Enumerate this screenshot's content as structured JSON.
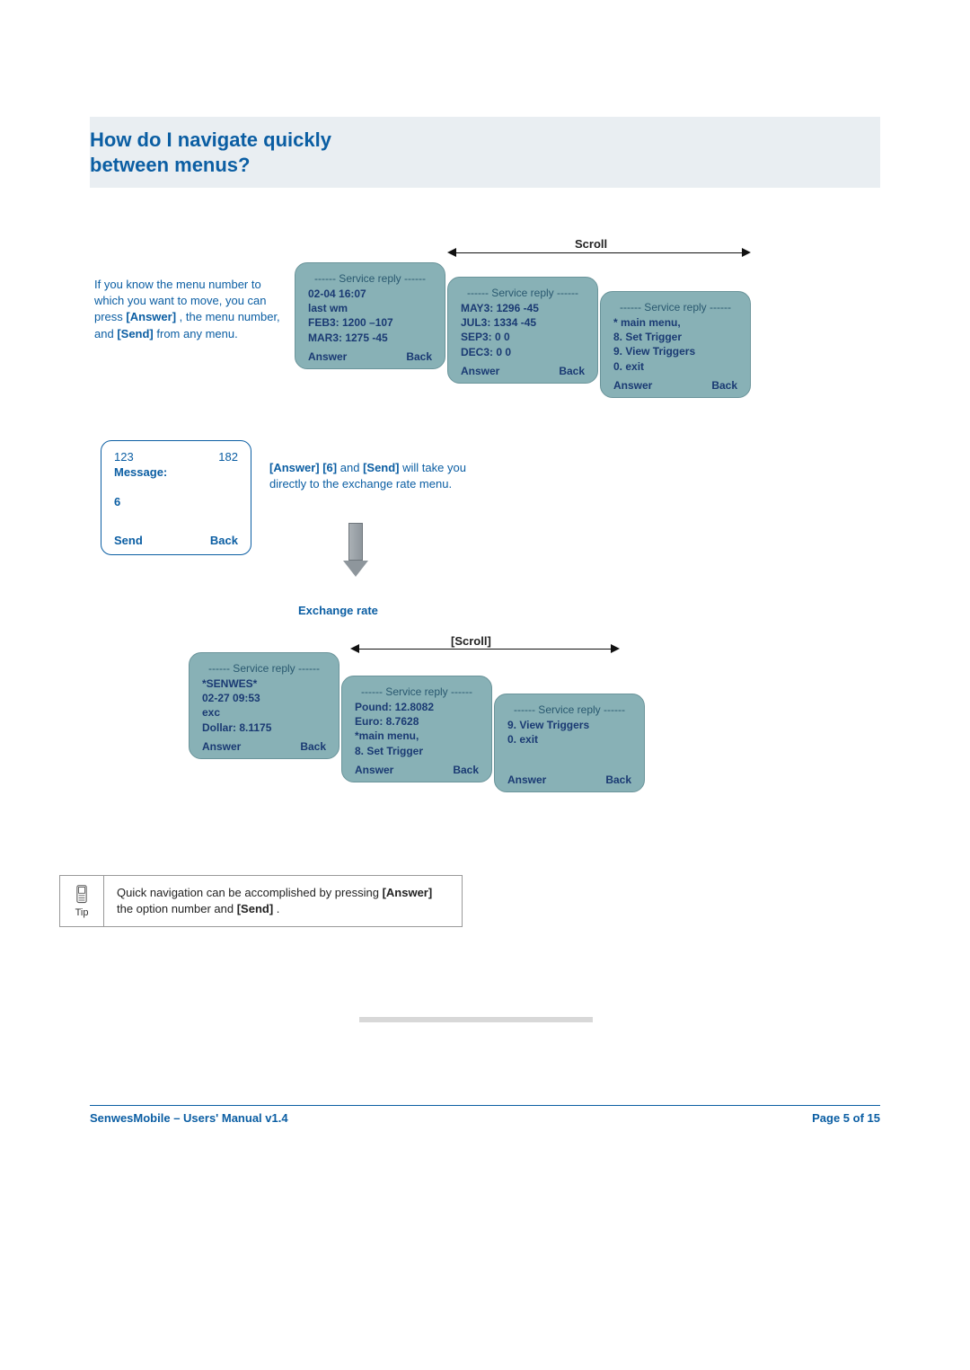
{
  "heading_line1": "How do I navigate quickly",
  "heading_line2": "between menus?",
  "intro": {
    "t1": "If you know the menu number to which you want to move, you can press ",
    "b1": "[Answer]",
    "t2": ", the menu number, and ",
    "b2": "[Send]",
    "t3": " from any menu."
  },
  "scroll_top": "Scroll",
  "scroll_bottom": "[Scroll]",
  "service_reply_hdr": "------ Service reply ------",
  "softkeys": {
    "answer": "Answer",
    "back": "Back",
    "send": "Send"
  },
  "top_boxes": {
    "a": [
      "02-04 16:07",
      "last wm",
      "FEB3: 1200 –107",
      "MAR3: 1275 -45"
    ],
    "b": [
      "MAY3: 1296 -45",
      "JUL3: 1334 -45",
      "SEP3: 0 0",
      "DEC3: 0 0"
    ],
    "c": [
      "* main menu,",
      "8. Set Trigger",
      "9. View Triggers",
      "0. exit"
    ]
  },
  "compose": {
    "left": "123",
    "right": "182",
    "label": "Message:",
    "value": "6"
  },
  "mid": {
    "b1": "[Answer] [6]",
    "t1": " and ",
    "b2": "[Send]",
    "t2": " will take you directly to the exchange rate menu."
  },
  "exchange_label": "Exchange rate",
  "ex_boxes": {
    "a": [
      "*SENWES*",
      "02-27 09:53",
      "exc",
      "Dollar: 8.1175"
    ],
    "b": [
      "Pound: 12.8082",
      "Euro: 8.7628",
      "*main menu,",
      "8. Set Trigger"
    ],
    "c": [
      "9. View Triggers",
      "0. exit"
    ]
  },
  "tip": {
    "label": "Tip",
    "t1": "Quick navigation can be accomplished by pressing ",
    "b1": "[Answer]",
    "t2": " the option number and ",
    "b2": "[Send]",
    "t3": "."
  },
  "footer": {
    "left": "SenwesMobile – Users' Manual v1.4",
    "right": "Page 5 of 15"
  }
}
